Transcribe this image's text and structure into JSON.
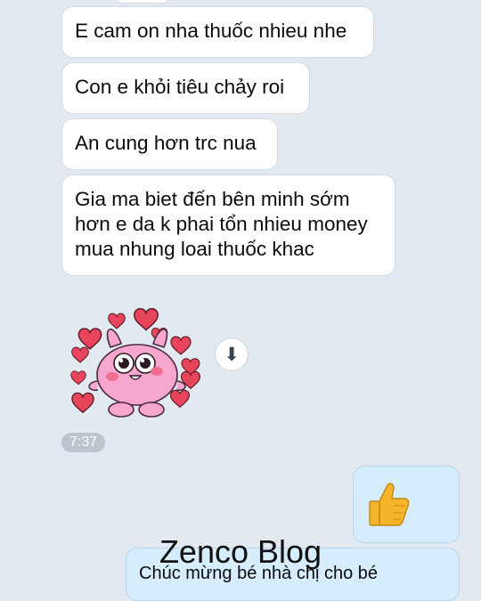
{
  "messages": [
    {
      "text": "E cam on nha thuốc nhieu nhe"
    },
    {
      "text": "Con e khỏi tiêu chảy roi"
    },
    {
      "text": "An cung hơn trc nua"
    },
    {
      "text": "Gia ma biet đến bên minh sớm hơn e da k phai tổn nhieu money mua nhung loai thuốc khac"
    }
  ],
  "sticker": {
    "icon": "pink-bunny-hearts-sticker"
  },
  "download": {
    "icon": "download-arrow-icon",
    "glyph": "⬇"
  },
  "time_badge": "7:37",
  "sent": {
    "thumbs_up_icon": "thumbs-up-icon",
    "last_message": "Chúc mừng bé nhà chị cho bé"
  },
  "watermark": "Zenco Blog",
  "colors": {
    "background": "#e2e9f1",
    "incoming_bubble": "#ffffff",
    "outgoing_bubble": "#d6edfd",
    "heart": "#e8455c",
    "bunny": "#f7a6cf"
  }
}
